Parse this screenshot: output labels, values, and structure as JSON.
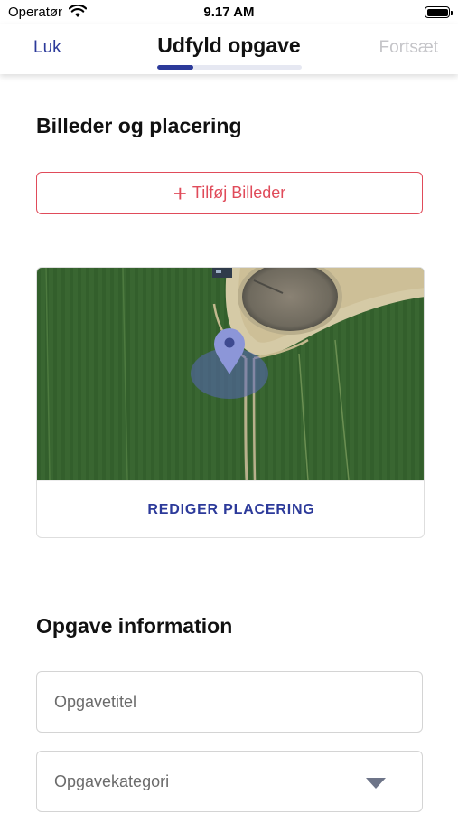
{
  "status_bar": {
    "carrier": "Operatør",
    "time": "9.17 AM",
    "wifi_icon": "wifi-icon",
    "battery_icon": "battery-icon"
  },
  "header": {
    "close_label": "Luk",
    "title": "Udfyld opgave",
    "continue_label": "Fortsæt",
    "progress": 0.25
  },
  "images_section": {
    "title": "Billeder og placering",
    "add_images_label": "Tilføj Billeder",
    "add_icon": "plus-icon"
  },
  "map": {
    "pin_icon": "map-pin-icon",
    "edit_location_label": "REDIGER PLACERING"
  },
  "info_section": {
    "title": "Opgave information",
    "task_title_placeholder": "Opgavetitel",
    "task_category_placeholder": "Opgavekategori",
    "dropdown_icon": "caret-down-icon"
  },
  "colors": {
    "accent": "#2c3a9a",
    "danger": "#e04b5a",
    "disabled": "#c4c4c8"
  }
}
